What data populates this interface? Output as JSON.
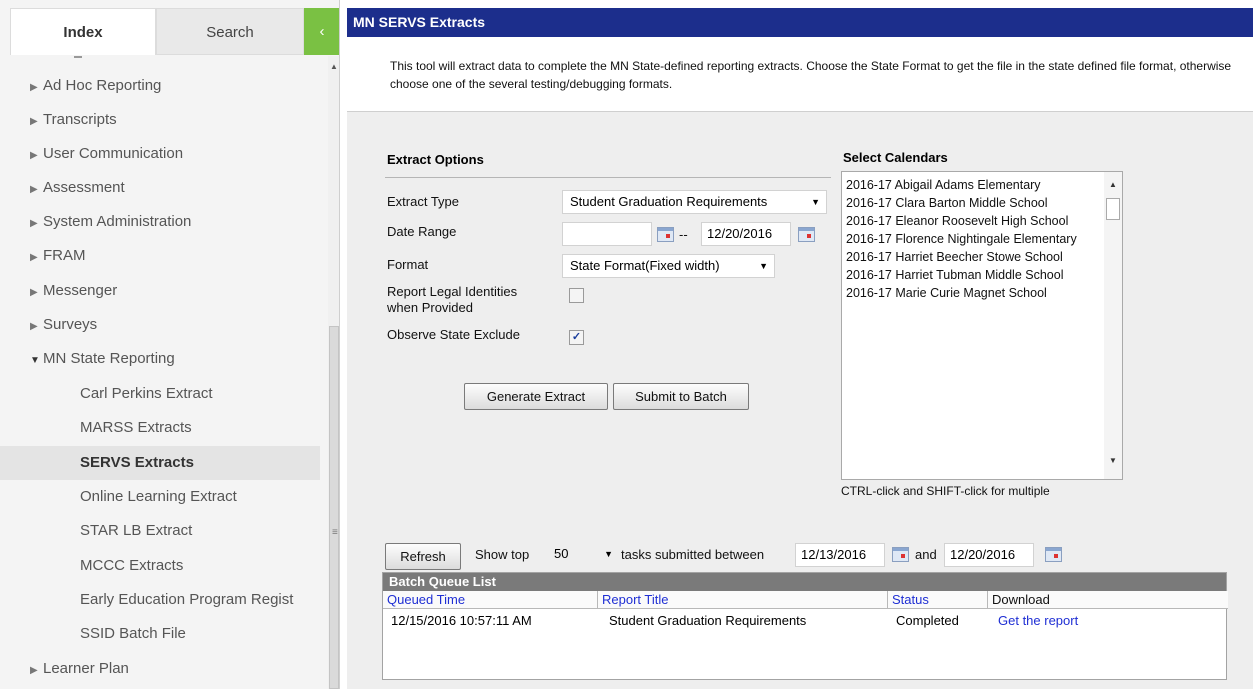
{
  "sidebar": {
    "tabs": {
      "index": "Index",
      "search": "Search",
      "collapse": "‹"
    },
    "items": [
      {
        "label": "Ad Hoc Reporting",
        "expanded": false
      },
      {
        "label": "Transcripts",
        "expanded": false
      },
      {
        "label": "User Communication",
        "expanded": false
      },
      {
        "label": "Assessment",
        "expanded": false
      },
      {
        "label": "System Administration",
        "expanded": false
      },
      {
        "label": "FRAM",
        "expanded": false
      },
      {
        "label": "Messenger",
        "expanded": false
      },
      {
        "label": "Surveys",
        "expanded": false
      },
      {
        "label": "MN State Reporting",
        "expanded": true
      }
    ],
    "subitems": [
      {
        "label": "Carl Perkins Extract"
      },
      {
        "label": "MARSS Extracts"
      },
      {
        "label": "SERVS Extracts",
        "active": true
      },
      {
        "label": "Online Learning Extract"
      },
      {
        "label": "STAR LB Extract"
      },
      {
        "label": "MCCC Extracts"
      },
      {
        "label": "Early Education Program Regist"
      },
      {
        "label": "SSID Batch File"
      }
    ],
    "after_items": [
      {
        "label": "Learner Plan",
        "expanded": false
      }
    ],
    "scroll_grip": "≡"
  },
  "header": {
    "title": "MN SERVS Extracts"
  },
  "description": "This tool will extract data to complete the MN State-defined reporting extracts. Choose the State Format to get the file in the state defined file format, otherwise choose one of the several testing/debugging formats.",
  "extract_options": {
    "heading": "Extract Options",
    "extract_type_label": "Extract Type",
    "extract_type_value": "Student Graduation Requirements",
    "date_range_label": "Date Range",
    "date_start": "",
    "date_separator": "--",
    "date_end": "12/20/2016",
    "format_label": "Format",
    "format_value": "State Format(Fixed width)",
    "legal_identities_label_line1": "Report Legal Identities",
    "legal_identities_label_line2": "when Provided",
    "legal_identities_checked": false,
    "observe_exclude_label": "Observe State Exclude",
    "observe_exclude_checked": true,
    "check_mark": "✓",
    "generate_button": "Generate Extract",
    "submit_button": "Submit to Batch"
  },
  "calendars": {
    "heading": "Select Calendars",
    "options": [
      "2016-17 Abigail Adams Elementary",
      "2016-17 Clara Barton Middle School",
      "2016-17 Eleanor Roosevelt High School",
      "2016-17 Florence Nightingale Elementary",
      "2016-17 Harriet Beecher Stowe School",
      "2016-17 Harriet Tubman Middle School",
      "2016-17 Marie Curie Magnet School"
    ],
    "hint": "CTRL-click and SHIFT-click for multiple"
  },
  "batch": {
    "refresh_button": "Refresh",
    "show_top_label": "Show top",
    "show_top_value": "50",
    "tasks_label": "tasks submitted between",
    "from_date": "12/13/2016",
    "and_label": "and",
    "to_date": "12/20/2016",
    "list_title": "Batch Queue List",
    "columns": [
      "Queued Time",
      "Report Title",
      "Status",
      "Download"
    ],
    "rows": [
      {
        "queued_time": "12/15/2016 10:57:11 AM",
        "report_title": "Student Graduation Requirements",
        "status": "Completed",
        "download": "Get the report"
      }
    ]
  },
  "colors": {
    "header_bg": "#1c2e8c",
    "collapse_green": "#7ac143",
    "link_blue": "#1f2fd4"
  }
}
